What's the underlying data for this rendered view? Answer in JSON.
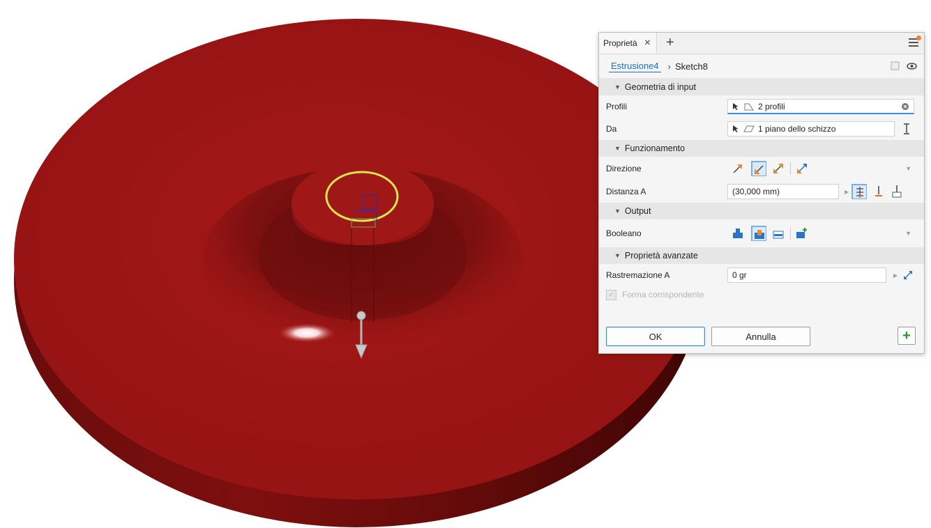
{
  "colors": {
    "part": "#9b1515",
    "part_dark": "#5e0a0a",
    "accent": "#3a8ee6",
    "link": "#1a72c8",
    "sketch_profile": "#d9e84a"
  },
  "panel": {
    "tab_label": "Proprietà",
    "breadcrumb": {
      "feature": "Estrusione4",
      "sketch": "Sketch8"
    },
    "sections": {
      "input": {
        "title": "Geometria di input"
      },
      "behavior": {
        "title": "Funzionamento"
      },
      "output": {
        "title": "Output"
      },
      "advanced": {
        "title": "Proprietà avanzate"
      }
    },
    "fields": {
      "profiles": {
        "label": "Profili",
        "value": "2 profili"
      },
      "from": {
        "label": "Da",
        "value": "1 piano dello schizzo"
      },
      "direction": {
        "label": "Direzione"
      },
      "distance": {
        "label": "Distanza A",
        "value": "(30,000 mm)"
      },
      "boolean": {
        "label": "Booleano"
      },
      "taper": {
        "label": "Rastremazione A",
        "value": "0 gr"
      },
      "match_shape": {
        "label": "Forma corrispondente",
        "checked": true,
        "enabled": false
      }
    },
    "buttons": {
      "ok": "OK",
      "cancel": "Annulla"
    },
    "icons": {
      "tab_close": "close-icon",
      "tab_add": "plus-icon",
      "menu": "hamburger-menu-icon",
      "select": "cursor-arrow-icon",
      "profile": "profile-shape-icon",
      "plane": "plane-icon",
      "clear": "clear-circle-icon",
      "visibility": "eye-icon",
      "sketch_toggle": "square-icon"
    }
  }
}
